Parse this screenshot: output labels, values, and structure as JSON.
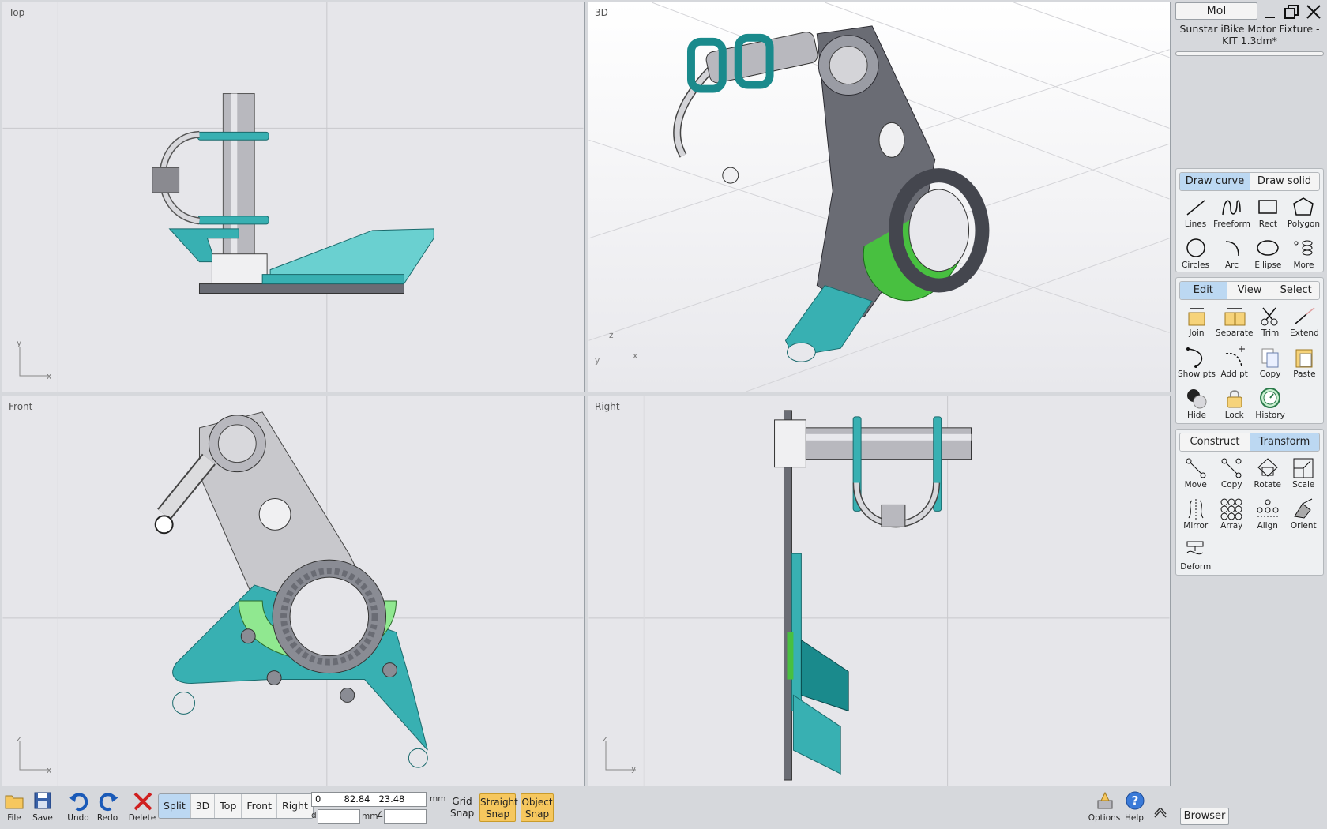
{
  "header": {
    "app_button": "MoI",
    "file_title": "Sunstar iBike Motor Fixture - KIT 1.3dm*"
  },
  "viewports": {
    "top": "Top",
    "perspective": "3D",
    "front": "Front",
    "right": "Right"
  },
  "axis": {
    "x": "x",
    "y": "y",
    "z": "z"
  },
  "draw_panel": {
    "tabs": [
      "Draw curve",
      "Draw solid"
    ],
    "tools": [
      "Lines",
      "Freeform",
      "Rect",
      "Polygon",
      "Circles",
      "Arc",
      "Ellipse",
      "More"
    ]
  },
  "edit_panel": {
    "tabs": [
      "Edit",
      "View",
      "Select"
    ],
    "tools": [
      "Join",
      "Separate",
      "Trim",
      "Extend",
      "Show pts",
      "Add pt",
      "Copy",
      "Paste",
      "Hide",
      "Lock",
      "History"
    ]
  },
  "transform_panel": {
    "tabs": [
      "Construct",
      "Transform"
    ],
    "tools": [
      "Move",
      "Copy",
      "Rotate",
      "Scale",
      "Mirror",
      "Array",
      "Align",
      "Orient",
      "Deform"
    ]
  },
  "bottom": {
    "file": "File",
    "save": "Save",
    "undo": "Undo",
    "redo": "Redo",
    "delete": "Delete",
    "views": [
      "Split",
      "3D",
      "Top",
      "Front",
      "Right"
    ],
    "coords": "0        82.84   23.48",
    "unit": "mm",
    "d_label": "d",
    "d_unit": "mm",
    "angle_symbol": "∠",
    "grid_snap_1": "Grid",
    "grid_snap_2": "Snap",
    "straight_1": "Straight",
    "straight_2": "Snap",
    "object_1": "Object",
    "object_2": "Snap",
    "options": "Options",
    "help": "Help",
    "browser": "Browser"
  },
  "colors": {
    "accent": "#bcd8f2",
    "snap_on": "#f6c75e",
    "teal": "#38b8b8",
    "green": "#48c040",
    "grey": "#6a6c74"
  }
}
